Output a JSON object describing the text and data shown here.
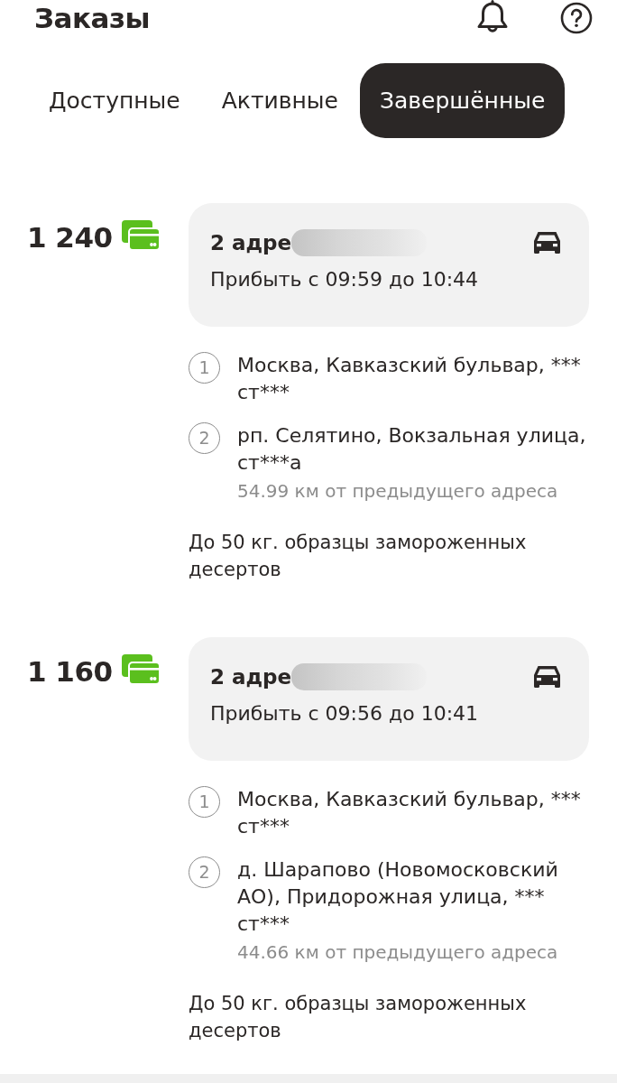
{
  "header": {
    "title": "Заказы"
  },
  "tabs": [
    {
      "label": "Доступные",
      "selected": false
    },
    {
      "label": "Активные",
      "selected": false
    },
    {
      "label": "Завершённые",
      "selected": true
    }
  ],
  "orders": [
    {
      "price": "1 240",
      "summary": {
        "title": "2 адре",
        "title_blurred": true,
        "arrival": "Прибыть с 09:59 до 10:44"
      },
      "addresses": [
        {
          "number": "1",
          "address": "Москва, Кавказский бульвар, *** ст***"
        },
        {
          "number": "2",
          "address": "рп. Селятино, Вокзальная улица, ст***а",
          "distance": "54.99 км от предыдущего адреса"
        }
      ],
      "description": "До 50 кг. образцы замороженных десертов"
    },
    {
      "price": "1 160",
      "summary": {
        "title": "2 адре",
        "title_blurred": true,
        "arrival": "Прибыть с 09:56 до 10:41"
      },
      "addresses": [
        {
          "number": "1",
          "address": "Москва, Кавказский бульвар, *** ст***"
        },
        {
          "number": "2",
          "address": "д. Шарапово (Новомосковский АО), Придорожная улица, *** ст***",
          "distance": "44.66 км от предыдущего адреса"
        }
      ],
      "description": "До 50 кг. образцы замороженных десертов"
    }
  ]
}
